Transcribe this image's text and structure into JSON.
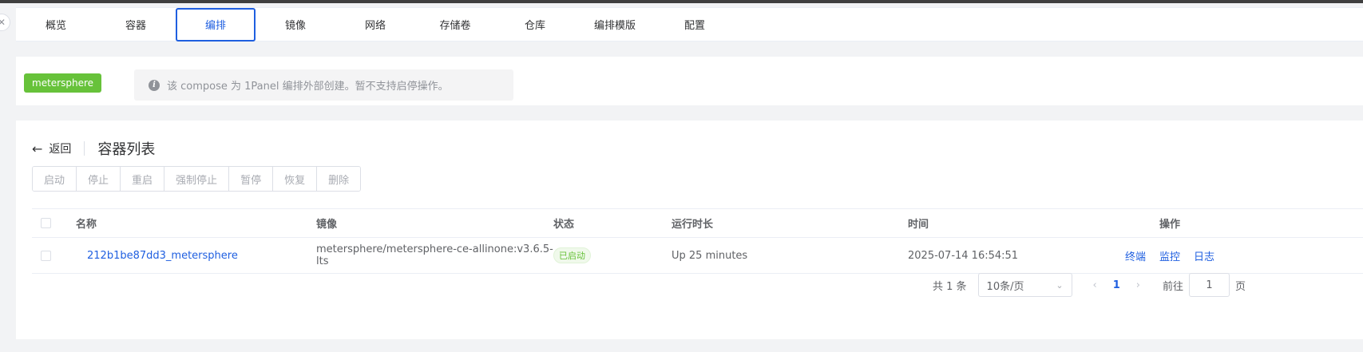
{
  "tabs": [
    {
      "label": "概览"
    },
    {
      "label": "容器"
    },
    {
      "label": "编排",
      "active": true
    },
    {
      "label": "镜像"
    },
    {
      "label": "网络"
    },
    {
      "label": "存储卷"
    },
    {
      "label": "仓库"
    },
    {
      "label": "编排模版"
    },
    {
      "label": "配置"
    }
  ],
  "compose": {
    "name": "metersphere",
    "notice": "该 compose 为 1Panel 编排外部创建。暂不支持启停操作。",
    "notice_icon": "info-icon"
  },
  "header": {
    "back_label": "返回",
    "title": "容器列表"
  },
  "actions": [
    "启动",
    "停止",
    "重启",
    "强制停止",
    "暂停",
    "恢复",
    "删除"
  ],
  "table": {
    "columns": {
      "name": "名称",
      "image": "镜像",
      "state": "状态",
      "uptime": "运行时长",
      "time": "时间",
      "ops": "操作"
    },
    "rows": [
      {
        "name": "212b1be87dd3_metersphere",
        "image": "metersphere/metersphere-ce-allinone:v3.6.5-lts",
        "state": "已启动",
        "uptime": "Up 25 minutes",
        "time": "2025-07-14 16:54:51",
        "ops": [
          "终端",
          "监控",
          "日志"
        ]
      }
    ]
  },
  "pagination": {
    "total_text": "共 1 条",
    "page_size": "10条/页",
    "current_page": "1",
    "goto_label": "前往",
    "goto_value": "1",
    "page_suffix": "页"
  },
  "colors": {
    "accent": "#1f5fe0",
    "success": "#67c23a"
  }
}
